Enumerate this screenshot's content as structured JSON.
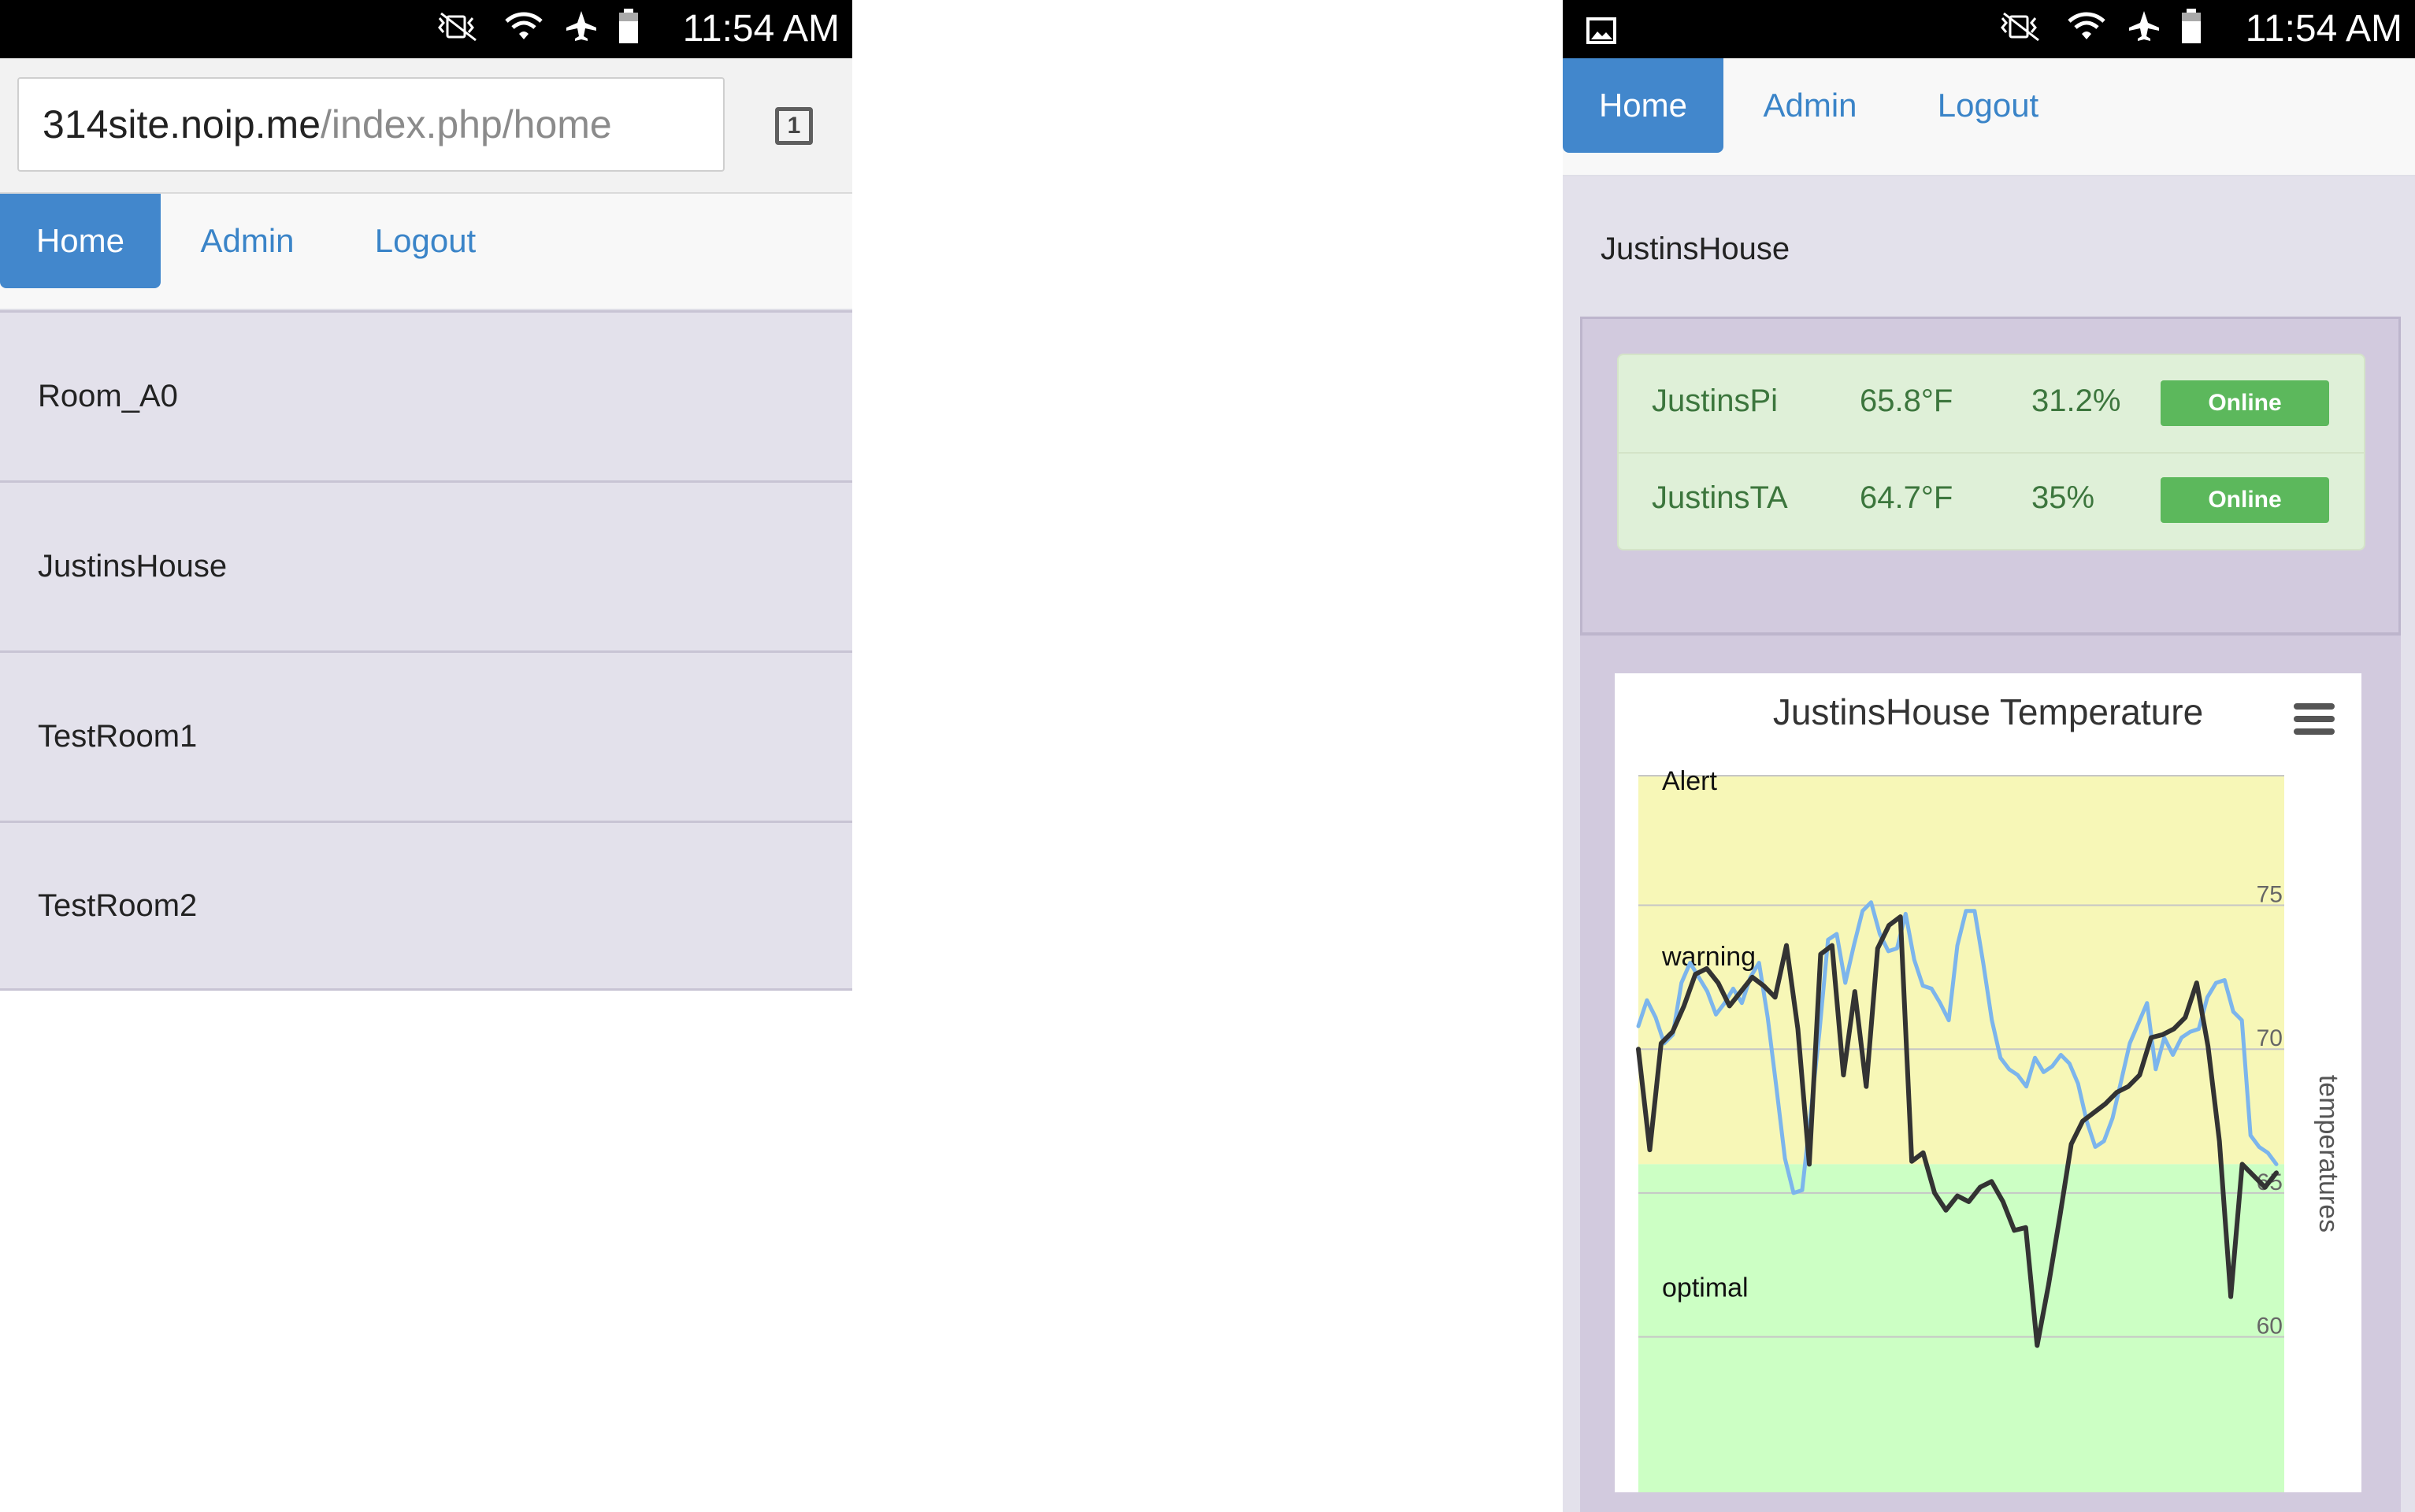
{
  "status_bar": {
    "left_time": "11:54 AM",
    "right_time": "11:54 AM",
    "icons": [
      "vibrate-mute-icon",
      "wifi-icon",
      "airplane-icon",
      "battery-icon"
    ],
    "right_extra_icon": "picture-icon"
  },
  "browser": {
    "url_domain": "314site.noip.me",
    "url_path": "/index.php/home",
    "tab_count": "1"
  },
  "nav": {
    "home": "Home",
    "admin": "Admin",
    "logout": "Logout"
  },
  "rooms": [
    "Room_A0",
    "JustinsHouse",
    "TestRoom1",
    "TestRoom2"
  ],
  "house": {
    "title": "JustinsHouse",
    "sensors": [
      {
        "name": "JustinsPi",
        "temperature": "65.8°F",
        "humidity": "31.2%",
        "status": "Online"
      },
      {
        "name": "JustinsTA",
        "temperature": "64.7°F",
        "humidity": "35%",
        "status": "Online"
      }
    ]
  },
  "colors": {
    "primary": "#4287cc",
    "link": "#3a84c8",
    "success": "#5cb85c",
    "success_background": "#dff0d8",
    "panel": "#e3e1eb",
    "chart_warning": "#f7f7b7",
    "chart_optimal": "#ccffc4",
    "series_light": "#7cb5ec",
    "series_dark": "#333333"
  },
  "chart_data": {
    "type": "line",
    "title": "JustinsHouse Temperature",
    "ylabel": "temperatures",
    "yrange_visible": [
      54.6,
      79.5
    ],
    "yticks": [
      75,
      70,
      65,
      60
    ],
    "grid": "horizontal lines",
    "legend": "none visible",
    "plot_bands": [
      {
        "label": "Alert",
        "from": 79.5,
        "to": 79.5,
        "color": "#f7f7b7"
      },
      {
        "label": "warning",
        "from": 66,
        "to": 79.5,
        "color": "#f7f7b7"
      },
      {
        "label": "optimal",
        "from": 54.6,
        "to": 66,
        "color": "#ccffc4"
      }
    ],
    "series": [
      {
        "name": "",
        "color": "#7cb5ec",
        "values": [
          70.8,
          71.7,
          71.1,
          70.2,
          70.5,
          72.3,
          73.0,
          72.5,
          72.0,
          71.2,
          71.6,
          72.1,
          71.6,
          72.5,
          73.0,
          71.1,
          68.7,
          66.2,
          65.0,
          65.1,
          67.8,
          70.6,
          73.8,
          74.0,
          72.3,
          73.6,
          74.8,
          75.1,
          74.0,
          73.4,
          73.5,
          74.7,
          73.1,
          72.2,
          72.1,
          71.6,
          71.0,
          73.6,
          74.8,
          74.8,
          73.0,
          71.0,
          69.7,
          69.3,
          69.1,
          68.7,
          69.7,
          69.2,
          69.4,
          69.8,
          69.5,
          68.8,
          67.5,
          66.6,
          66.8,
          67.6,
          68.9,
          70.2,
          70.9,
          71.6,
          69.3,
          70.4,
          69.8,
          70.4,
          70.6,
          70.7,
          71.8,
          72.3,
          72.4,
          71.3,
          71.0,
          67.0,
          66.6,
          66.4,
          66.0
        ]
      },
      {
        "name": "",
        "color": "#333333",
        "values": [
          70.0,
          66.5,
          70.2,
          70.6,
          71.5,
          72.6,
          72.8,
          72.3,
          71.5,
          72.0,
          72.5,
          72.2,
          71.8,
          73.6,
          70.7,
          66.0,
          73.3,
          73.6,
          69.1,
          72.0,
          68.7,
          73.5,
          74.3,
          74.6,
          66.1,
          66.4,
          65.0,
          64.4,
          64.9,
          64.7,
          65.2,
          65.4,
          64.7,
          63.7,
          63.8,
          59.7,
          61.8,
          64.2,
          66.7,
          67.5,
          67.8,
          68.1,
          68.5,
          68.7,
          69.1,
          70.4,
          70.5,
          70.7,
          71.1,
          72.3,
          70.1,
          66.8,
          61.4,
          66.0,
          65.6,
          65.2,
          65.7
        ]
      }
    ]
  }
}
